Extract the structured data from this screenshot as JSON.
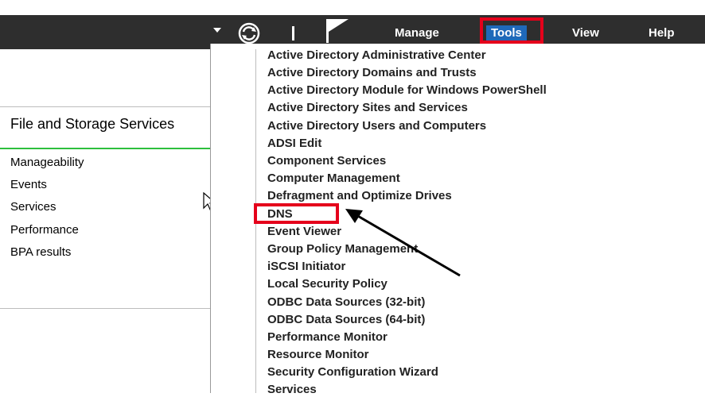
{
  "header": {
    "menu": [
      {
        "label": "Manage"
      },
      {
        "label": "Tools"
      },
      {
        "label": "View"
      },
      {
        "label": "Help"
      }
    ],
    "icons": [
      "chevron-down-icon",
      "refresh-icon",
      "flag-icon"
    ]
  },
  "sidebar": {
    "section_title": "File and Storage Services",
    "items": [
      {
        "label": "Manageability"
      },
      {
        "label": "Events"
      },
      {
        "label": "Services"
      },
      {
        "label": "Performance"
      },
      {
        "label": "BPA results"
      }
    ]
  },
  "tools_menu": {
    "items": [
      {
        "label": "Active Directory Administrative Center"
      },
      {
        "label": "Active Directory Domains and Trusts"
      },
      {
        "label": "Active Directory Module for Windows PowerShell"
      },
      {
        "label": "Active Directory Sites and Services"
      },
      {
        "label": "Active Directory Users and Computers"
      },
      {
        "label": "ADSI Edit"
      },
      {
        "label": "Component Services"
      },
      {
        "label": "Computer Management"
      },
      {
        "label": "Defragment and Optimize Drives"
      },
      {
        "label": "DNS"
      },
      {
        "label": "Event Viewer"
      },
      {
        "label": "Group Policy Management"
      },
      {
        "label": "iSCSI Initiator"
      },
      {
        "label": "Local Security Policy"
      },
      {
        "label": "ODBC Data Sources (32-bit)"
      },
      {
        "label": "ODBC Data Sources (64-bit)"
      },
      {
        "label": "Performance Monitor"
      },
      {
        "label": "Resource Monitor"
      },
      {
        "label": "Security Configuration Wizard"
      },
      {
        "label": "Services"
      }
    ]
  },
  "colors": {
    "highlight": "#e5001b",
    "accent": "#1f69b9",
    "titlebar": "#2e2e2e",
    "section_underline": "#2dbf3d"
  }
}
